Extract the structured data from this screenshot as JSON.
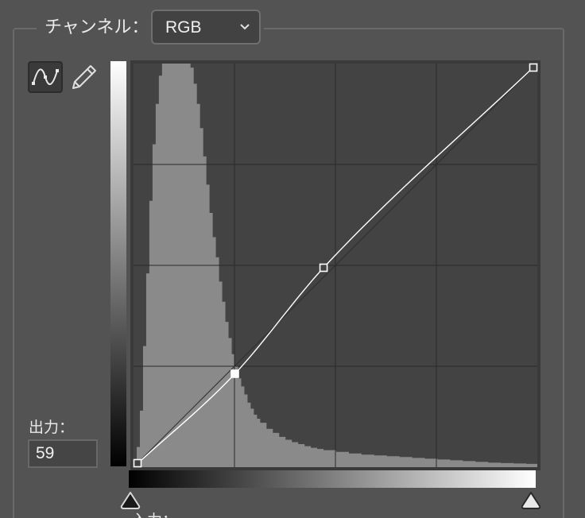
{
  "channel": {
    "label": "チャンネル：",
    "selected": "RGB"
  },
  "tools": {
    "curve_tool_icon": "curve-tool-icon",
    "pencil_tool_icon": "pencil-icon"
  },
  "output": {
    "label": "出力：",
    "value": "59"
  },
  "input": {
    "label": "入力："
  },
  "curve": {
    "points": [
      {
        "input": 0,
        "output": 0
      },
      {
        "input": 64,
        "output": 59
      },
      {
        "input": 120,
        "output": 126
      },
      {
        "input": 255,
        "output": 255
      }
    ],
    "selected_point_index": 1
  },
  "histogram": {
    "bins_input": [
      0,
      2,
      4,
      6,
      8,
      10,
      12,
      14,
      16,
      18,
      20,
      22,
      24,
      26,
      28,
      30,
      32,
      34,
      36,
      38,
      40,
      42,
      44,
      46,
      48,
      50,
      52,
      54,
      56,
      58,
      60,
      62,
      64,
      66,
      68,
      70,
      72,
      74,
      76,
      78,
      80,
      84,
      88,
      92,
      96,
      100,
      104,
      108,
      112,
      116,
      120,
      128,
      136,
      144,
      152,
      160,
      168,
      176,
      184,
      192,
      200,
      208,
      216,
      224,
      232,
      240,
      248,
      255
    ],
    "levels": [
      0.01,
      0.05,
      0.14,
      0.3,
      0.48,
      0.66,
      0.8,
      0.9,
      0.97,
      1.0,
      1.0,
      1.0,
      1.0,
      1.0,
      1.0,
      1.0,
      1.0,
      1.0,
      0.99,
      0.95,
      0.9,
      0.84,
      0.77,
      0.7,
      0.63,
      0.57,
      0.52,
      0.46,
      0.41,
      0.36,
      0.32,
      0.28,
      0.25,
      0.22,
      0.2,
      0.18,
      0.16,
      0.145,
      0.13,
      0.12,
      0.11,
      0.095,
      0.085,
      0.075,
      0.068,
      0.062,
      0.057,
      0.052,
      0.048,
      0.045,
      0.042,
      0.038,
      0.034,
      0.031,
      0.029,
      0.027,
      0.025,
      0.023,
      0.021,
      0.019,
      0.017,
      0.015,
      0.013,
      0.011,
      0.01,
      0.009,
      0.008,
      0.007
    ]
  },
  "colors": {
    "panel_bg": "#535353",
    "graph_bg": "#434343",
    "histogram": "#8a8a8a",
    "grid": "#2a2a2a",
    "curve": "#ffffff"
  }
}
